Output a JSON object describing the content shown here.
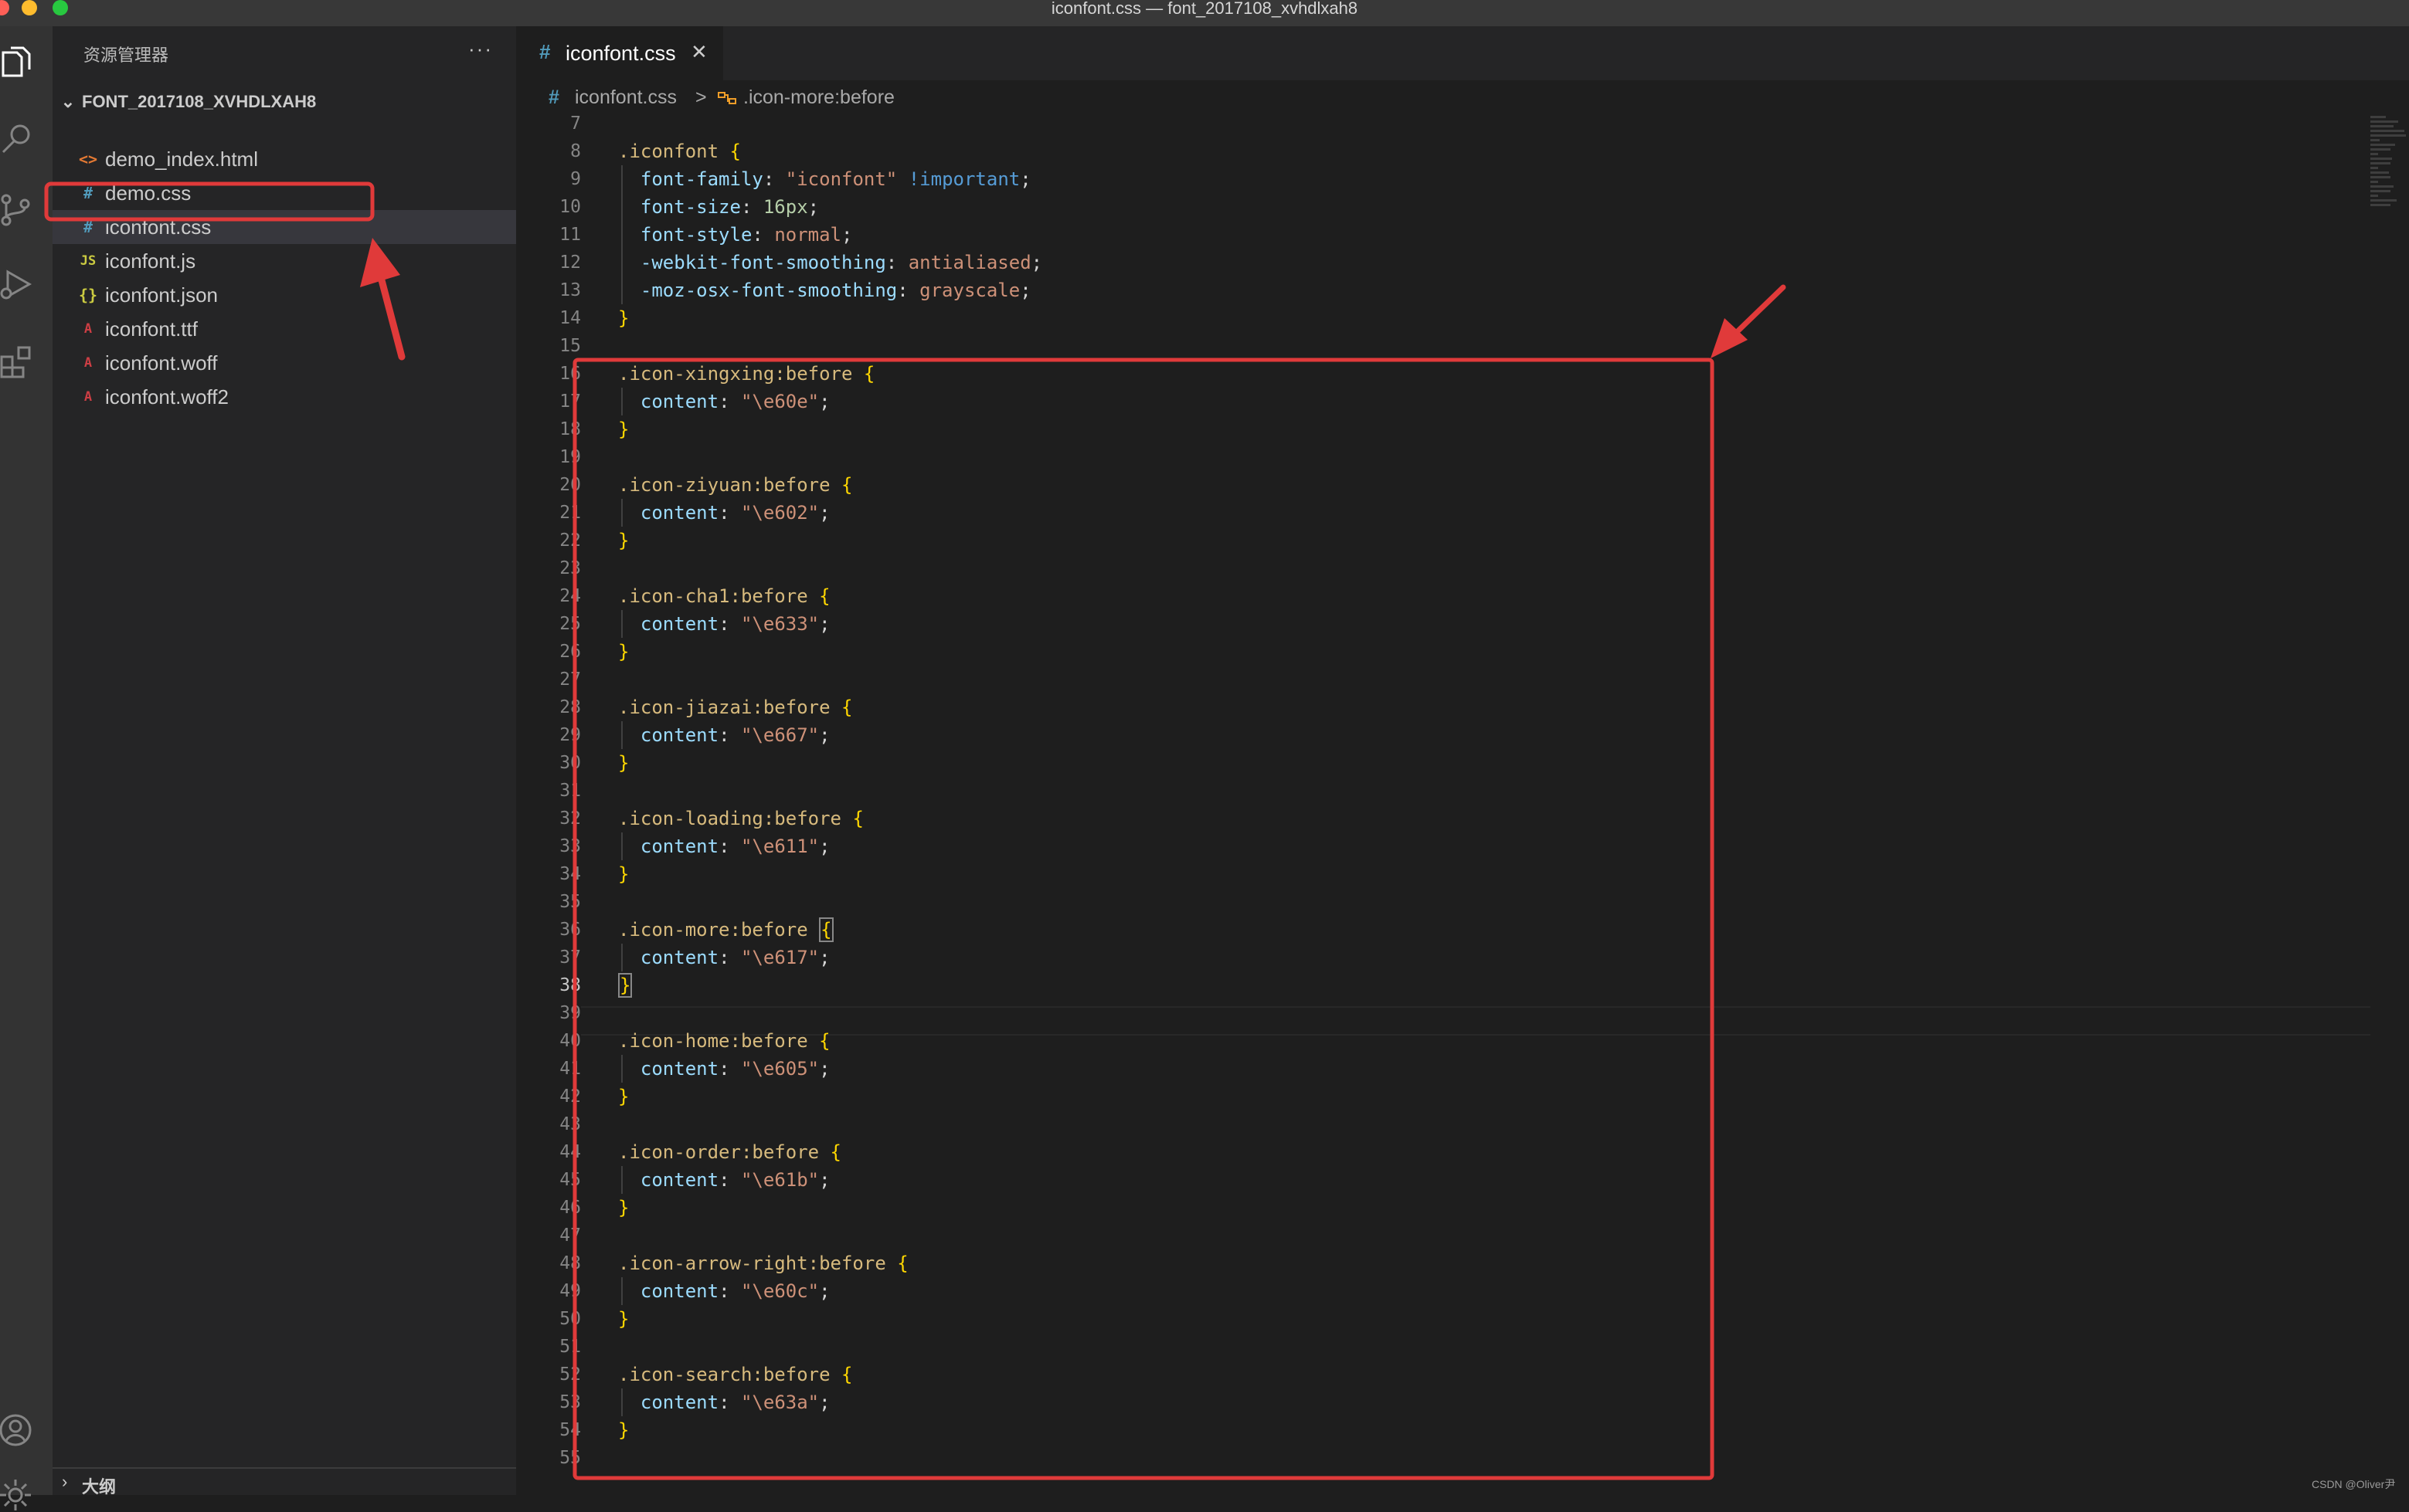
{
  "window": {
    "title": "iconfont.css — font_2017108_xvhdlxah8"
  },
  "colors": {
    "accent_red": "#e03a3a",
    "css_icon": "#519aba",
    "js_icon": "#cbcb41",
    "json_icon": "#cbcb41",
    "font_icon": "#cc3e44",
    "html_icon": "#e37933"
  },
  "activity_bar": [
    {
      "name": "explorer-icon"
    },
    {
      "name": "search-icon"
    },
    {
      "name": "source-control-icon"
    },
    {
      "name": "run-debug-icon"
    },
    {
      "name": "extensions-icon"
    },
    {
      "name": "account-icon"
    },
    {
      "name": "settings-gear-icon"
    }
  ],
  "sidebar": {
    "title": "资源管理器",
    "more": "···",
    "folder": "FONT_2017108_XVHDLXAH8",
    "files": [
      {
        "label": "demo_index.html",
        "glyph": "<>",
        "kind": "html-file-icon"
      },
      {
        "label": "demo.css",
        "glyph": "#",
        "kind": "css-file-icon"
      },
      {
        "label": "iconfont.css",
        "glyph": "#",
        "kind": "css-file-icon"
      },
      {
        "label": "iconfont.js",
        "glyph": "JS",
        "kind": "js-file-icon"
      },
      {
        "label": "iconfont.json",
        "glyph": "{}",
        "kind": "json-file-icon"
      },
      {
        "label": "iconfont.ttf",
        "glyph": "A",
        "kind": "font-file-icon"
      },
      {
        "label": "iconfont.woff",
        "glyph": "A",
        "kind": "font-file-icon"
      },
      {
        "label": "iconfont.woff2",
        "glyph": "A",
        "kind": "font-file-icon"
      }
    ],
    "active_index": 2,
    "outline_label": "大纲"
  },
  "tab": {
    "hash": "#",
    "name": "iconfont.css",
    "close": "✕"
  },
  "breadcrumb": {
    "hash": "#",
    "file": "iconfont.css",
    "separator": ">",
    "symbol": ".icon-more:before"
  },
  "editor": {
    "current_line": "38",
    "lines": [
      {
        "n": "7",
        "t": []
      },
      {
        "n": "8",
        "t": [
          [
            "sel",
            ".iconfont"
          ],
          [
            "plain",
            " "
          ],
          [
            "brace",
            "{"
          ]
        ]
      },
      {
        "n": "9",
        "t": [
          [
            "plain",
            "  "
          ],
          [
            "prop",
            "font-family"
          ],
          [
            "plain",
            ": "
          ],
          [
            "str",
            "\"iconfont\""
          ],
          [
            "plain",
            " "
          ],
          [
            "imp",
            "!important"
          ],
          [
            "plain",
            ";"
          ]
        ]
      },
      {
        "n": "10",
        "t": [
          [
            "plain",
            "  "
          ],
          [
            "prop",
            "font-size"
          ],
          [
            "plain",
            ": "
          ],
          [
            "num",
            "16px"
          ],
          [
            "plain",
            ";"
          ]
        ]
      },
      {
        "n": "11",
        "t": [
          [
            "plain",
            "  "
          ],
          [
            "prop",
            "font-style"
          ],
          [
            "plain",
            ": "
          ],
          [
            "str",
            "normal"
          ],
          [
            "plain",
            ";"
          ]
        ]
      },
      {
        "n": "12",
        "t": [
          [
            "plain",
            "  "
          ],
          [
            "prop",
            "-webkit-font-smoothing"
          ],
          [
            "plain",
            ": "
          ],
          [
            "str",
            "antialiased"
          ],
          [
            "plain",
            ";"
          ]
        ]
      },
      {
        "n": "13",
        "t": [
          [
            "plain",
            "  "
          ],
          [
            "prop",
            "-moz-osx-font-smoothing"
          ],
          [
            "plain",
            ": "
          ],
          [
            "str",
            "grayscale"
          ],
          [
            "plain",
            ";"
          ]
        ]
      },
      {
        "n": "14",
        "t": [
          [
            "brace",
            "}"
          ]
        ]
      },
      {
        "n": "15",
        "t": []
      },
      {
        "n": "16",
        "t": [
          [
            "sel",
            ".icon-xingxing:before"
          ],
          [
            "plain",
            " "
          ],
          [
            "brace",
            "{"
          ]
        ]
      },
      {
        "n": "17",
        "t": [
          [
            "plain",
            "  "
          ],
          [
            "prop",
            "content"
          ],
          [
            "plain",
            ": "
          ],
          [
            "str",
            "\"\\e60e\""
          ],
          [
            "plain",
            ";"
          ]
        ]
      },
      {
        "n": "18",
        "t": [
          [
            "brace",
            "}"
          ]
        ]
      },
      {
        "n": "19",
        "t": []
      },
      {
        "n": "20",
        "t": [
          [
            "sel",
            ".icon-ziyuan:before"
          ],
          [
            "plain",
            " "
          ],
          [
            "brace",
            "{"
          ]
        ]
      },
      {
        "n": "21",
        "t": [
          [
            "plain",
            "  "
          ],
          [
            "prop",
            "content"
          ],
          [
            "plain",
            ": "
          ],
          [
            "str",
            "\"\\e602\""
          ],
          [
            "plain",
            ";"
          ]
        ]
      },
      {
        "n": "22",
        "t": [
          [
            "brace",
            "}"
          ]
        ]
      },
      {
        "n": "23",
        "t": []
      },
      {
        "n": "24",
        "t": [
          [
            "sel",
            ".icon-cha1:before"
          ],
          [
            "plain",
            " "
          ],
          [
            "brace",
            "{"
          ]
        ]
      },
      {
        "n": "25",
        "t": [
          [
            "plain",
            "  "
          ],
          [
            "prop",
            "content"
          ],
          [
            "plain",
            ": "
          ],
          [
            "str",
            "\"\\e633\""
          ],
          [
            "plain",
            ";"
          ]
        ]
      },
      {
        "n": "26",
        "t": [
          [
            "brace",
            "}"
          ]
        ]
      },
      {
        "n": "27",
        "t": []
      },
      {
        "n": "28",
        "t": [
          [
            "sel",
            ".icon-jiazai:before"
          ],
          [
            "plain",
            " "
          ],
          [
            "brace",
            "{"
          ]
        ]
      },
      {
        "n": "29",
        "t": [
          [
            "plain",
            "  "
          ],
          [
            "prop",
            "content"
          ],
          [
            "plain",
            ": "
          ],
          [
            "str",
            "\"\\e667\""
          ],
          [
            "plain",
            ";"
          ]
        ]
      },
      {
        "n": "30",
        "t": [
          [
            "brace",
            "}"
          ]
        ]
      },
      {
        "n": "31",
        "t": []
      },
      {
        "n": "32",
        "t": [
          [
            "sel",
            ".icon-loading:before"
          ],
          [
            "plain",
            " "
          ],
          [
            "brace",
            "{"
          ]
        ]
      },
      {
        "n": "33",
        "t": [
          [
            "plain",
            "  "
          ],
          [
            "prop",
            "content"
          ],
          [
            "plain",
            ": "
          ],
          [
            "str",
            "\"\\e611\""
          ],
          [
            "plain",
            ";"
          ]
        ]
      },
      {
        "n": "34",
        "t": [
          [
            "brace",
            "}"
          ]
        ]
      },
      {
        "n": "35",
        "t": []
      },
      {
        "n": "36",
        "t": [
          [
            "sel",
            ".icon-more:before"
          ],
          [
            "plain",
            " "
          ],
          [
            "bm",
            "{"
          ]
        ]
      },
      {
        "n": "37",
        "t": [
          [
            "plain",
            "  "
          ],
          [
            "prop",
            "content"
          ],
          [
            "plain",
            ": "
          ],
          [
            "str",
            "\"\\e617\""
          ],
          [
            "plain",
            ";"
          ]
        ]
      },
      {
        "n": "38",
        "t": [
          [
            "bm",
            "}"
          ]
        ]
      },
      {
        "n": "39",
        "t": []
      },
      {
        "n": "40",
        "t": [
          [
            "sel",
            ".icon-home:before"
          ],
          [
            "plain",
            " "
          ],
          [
            "brace",
            "{"
          ]
        ]
      },
      {
        "n": "41",
        "t": [
          [
            "plain",
            "  "
          ],
          [
            "prop",
            "content"
          ],
          [
            "plain",
            ": "
          ],
          [
            "str",
            "\"\\e605\""
          ],
          [
            "plain",
            ";"
          ]
        ]
      },
      {
        "n": "42",
        "t": [
          [
            "brace",
            "}"
          ]
        ]
      },
      {
        "n": "43",
        "t": []
      },
      {
        "n": "44",
        "t": [
          [
            "sel",
            ".icon-order:before"
          ],
          [
            "plain",
            " "
          ],
          [
            "brace",
            "{"
          ]
        ]
      },
      {
        "n": "45",
        "t": [
          [
            "plain",
            "  "
          ],
          [
            "prop",
            "content"
          ],
          [
            "plain",
            ": "
          ],
          [
            "str",
            "\"\\e61b\""
          ],
          [
            "plain",
            ";"
          ]
        ]
      },
      {
        "n": "46",
        "t": [
          [
            "brace",
            "}"
          ]
        ]
      },
      {
        "n": "47",
        "t": []
      },
      {
        "n": "48",
        "t": [
          [
            "sel",
            ".icon-arrow-right:before"
          ],
          [
            "plain",
            " "
          ],
          [
            "brace",
            "{"
          ]
        ]
      },
      {
        "n": "49",
        "t": [
          [
            "plain",
            "  "
          ],
          [
            "prop",
            "content"
          ],
          [
            "plain",
            ": "
          ],
          [
            "str",
            "\"\\e60c\""
          ],
          [
            "plain",
            ";"
          ]
        ]
      },
      {
        "n": "50",
        "t": [
          [
            "brace",
            "}"
          ]
        ]
      },
      {
        "n": "51",
        "t": []
      },
      {
        "n": "52",
        "t": [
          [
            "sel",
            ".icon-search:before"
          ],
          [
            "plain",
            " "
          ],
          [
            "brace",
            "{"
          ]
        ]
      },
      {
        "n": "53",
        "t": [
          [
            "plain",
            "  "
          ],
          [
            "prop",
            "content"
          ],
          [
            "plain",
            ": "
          ],
          [
            "str",
            "\"\\e63a\""
          ],
          [
            "plain",
            ";"
          ]
        ]
      },
      {
        "n": "54",
        "t": [
          [
            "brace",
            "}"
          ]
        ]
      },
      {
        "n": "55",
        "t": []
      }
    ]
  },
  "watermark": "CSDN @Oliver尹"
}
